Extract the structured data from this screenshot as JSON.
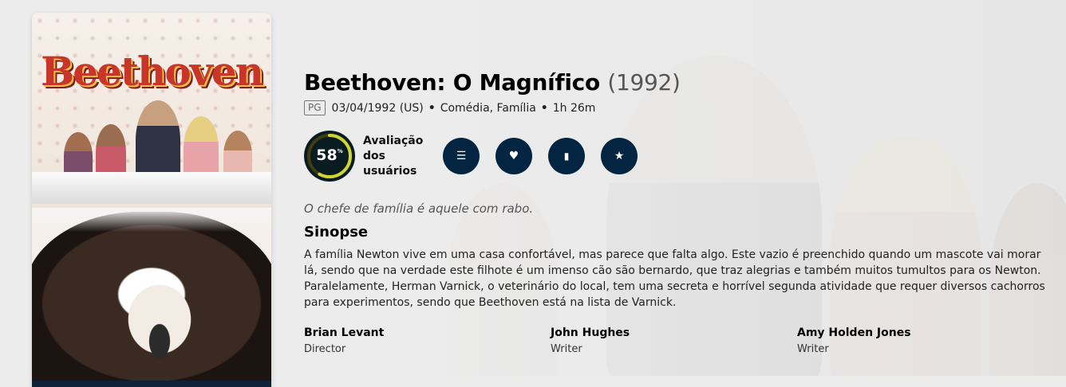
{
  "poster": {
    "title_art": "Beethoven"
  },
  "movie": {
    "title": "Beethoven: O Magnífico",
    "year": "(1992)",
    "certification": "PG",
    "release": "03/04/1992 (US)",
    "genres": "Comédia, Família",
    "runtime": "1h 26m"
  },
  "score": {
    "value": "58",
    "percent_sign": "%",
    "fraction": 0.58,
    "label_lines": [
      "Avaliação",
      "dos",
      "usuários"
    ],
    "ring_color": "#d2d531",
    "ring_track_color": "#423d0f"
  },
  "actions": [
    {
      "icon": "list-icon",
      "glyph": "☰"
    },
    {
      "icon": "heart-icon",
      "glyph": "♥"
    },
    {
      "icon": "bookmark-icon",
      "glyph": "▮"
    },
    {
      "icon": "star-icon",
      "glyph": "★"
    }
  ],
  "tagline": "O chefe de família é aquele com rabo.",
  "synopsis_heading": "Sinopse",
  "overview": "A família Newton vive em uma casa confortável, mas parece que falta algo. Este vazio é preenchido quando um mascote vai morar lá, sendo que na verdade este filhote é um imenso cão são bernardo, que traz alegrias e também muitos tumultos para os Newton. Paralelamente, Herman Varnick, o veterinário do local, tem uma secreta e horrível segunda atividade que requer diversos cachorros para experimentos, sendo que Beethoven está na lista de Varnick.",
  "crew": [
    {
      "name": "Brian Levant",
      "role": "Director"
    },
    {
      "name": "John Hughes",
      "role": "Writer"
    },
    {
      "name": "Amy Holden Jones",
      "role": "Writer"
    }
  ],
  "colors": {
    "action_button": "#032541",
    "score_background": "#081c22"
  }
}
